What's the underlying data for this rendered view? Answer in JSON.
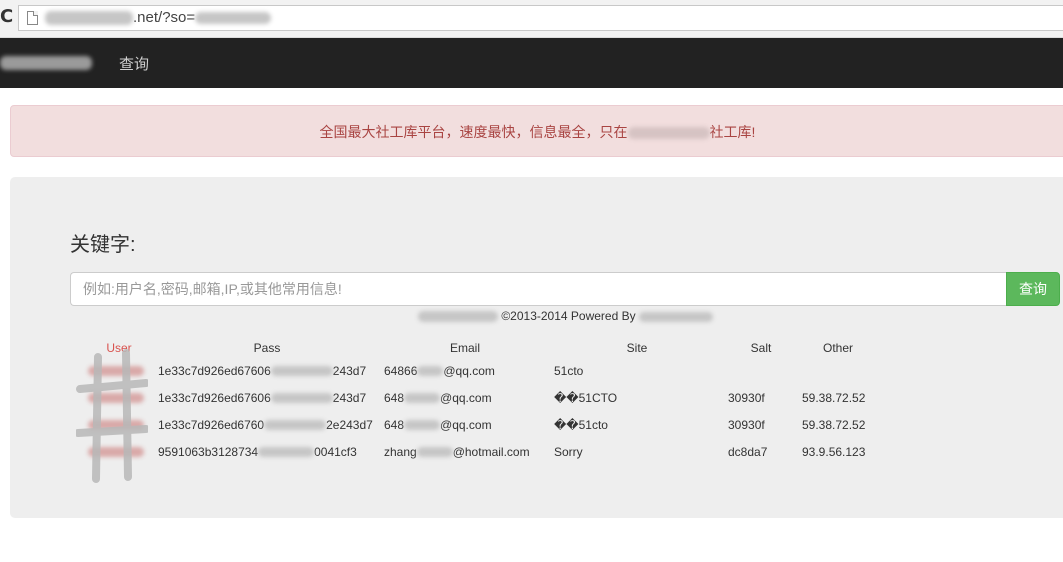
{
  "browser": {
    "url_domain_suffix": ".net",
    "url_query": "/?so="
  },
  "navbar": {
    "query_link": "查询"
  },
  "alert": {
    "text_before": "全国最大社工库平台，速度最快，信息最全，只在",
    "text_after": "社工库!"
  },
  "search": {
    "label": "关键字:",
    "placeholder": "例如:用户名,密码,邮箱,IP,或其他常用信息!",
    "button_label": "查询"
  },
  "footer": {
    "text": "©2013-2014 Powered By"
  },
  "table": {
    "headers": [
      "User",
      "Pass",
      "Email",
      "Site",
      "Salt",
      "Other"
    ],
    "rows": [
      {
        "user": "",
        "pass_prefix": "1e33c7d926ed67606",
        "pass_suffix": "243d7",
        "email_prefix": "64866",
        "email_suffix": "@qq.com",
        "site": "51cto",
        "salt": "",
        "other": ""
      },
      {
        "user": "",
        "pass_prefix": "1e33c7d926ed67606",
        "pass_suffix": "243d7",
        "email_prefix": "648",
        "email_suffix": "@qq.com",
        "site": "��51CTO",
        "salt": "30930f",
        "other": "59.38.72.52"
      },
      {
        "user": "",
        "pass_prefix": "1e33c7d926ed6760",
        "pass_suffix": "2e243d7",
        "email_prefix": "648",
        "email_suffix": "@qq.com",
        "site": "��51cto",
        "salt": "30930f",
        "other": "59.38.72.52"
      },
      {
        "user": "",
        "pass_prefix": "9591063b3128734",
        "pass_suffix": "0041cf3",
        "email_prefix": "zhang",
        "email_suffix": "@hotmail.com",
        "site": "Sorry",
        "salt": "dc8da7",
        "other": "93.9.56.123"
      }
    ]
  },
  "colors": {
    "navbar_bg": "#222222",
    "alert_bg": "#f2dede",
    "alert_text": "#a94442",
    "button_green": "#5cb85c",
    "user_red": "#d9534f"
  }
}
